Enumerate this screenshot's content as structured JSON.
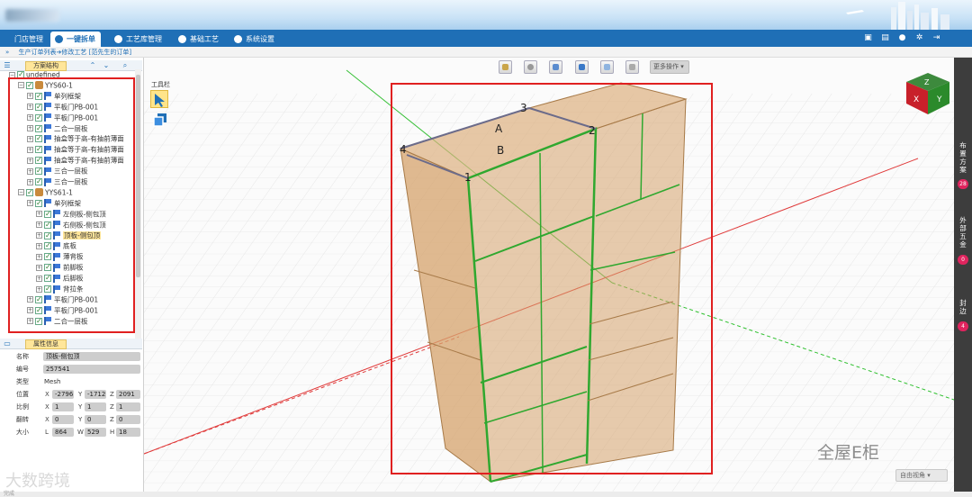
{
  "header": {
    "logo_blurred": "blurred-logo"
  },
  "nav": {
    "tabs": [
      {
        "label": "门店管理",
        "icon": "none",
        "active": false
      },
      {
        "label": "一键拆单",
        "icon": "check-circle-icon",
        "active": true
      },
      {
        "label": "工艺库管理",
        "icon": "check-circle-icon",
        "active": false
      },
      {
        "label": "基础工艺",
        "icon": "check-circle-icon",
        "active": false
      },
      {
        "label": "系统设置",
        "icon": "check-circle-icon",
        "active": false
      }
    ],
    "right_icons": [
      "calendar-icon",
      "lock-icon",
      "user-icon",
      "gear-icon",
      "exit-icon"
    ]
  },
  "breadcrumb": {
    "chevron": "»",
    "text": "生产订单列表➔修改工艺 [范先生的订单]"
  },
  "left_panel": {
    "tab_label": "方案结构",
    "tree": [
      {
        "label": "undefined",
        "indent": 0,
        "icon": "none"
      },
      {
        "label": "YYS60-1",
        "indent": 1,
        "icon": "box"
      },
      {
        "label": "单列框架",
        "indent": 2,
        "icon": "flag"
      },
      {
        "label": "平板门PB-001",
        "indent": 2,
        "icon": "flag"
      },
      {
        "label": "平板门PB-001",
        "indent": 2,
        "icon": "flag"
      },
      {
        "label": "二合一层板",
        "indent": 2,
        "icon": "flag"
      },
      {
        "label": "抽盒等于高-有抽前薄面",
        "indent": 2,
        "icon": "flag"
      },
      {
        "label": "抽盒等于高-有抽前薄面",
        "indent": 2,
        "icon": "flag"
      },
      {
        "label": "抽盒等于高-有抽前薄面",
        "indent": 2,
        "icon": "flag"
      },
      {
        "label": "三合一层板",
        "indent": 2,
        "icon": "flag"
      },
      {
        "label": "三合一层板",
        "indent": 2,
        "icon": "flag"
      },
      {
        "label": "YYS61-1",
        "indent": 1,
        "icon": "box"
      },
      {
        "label": "单列框架",
        "indent": 2,
        "icon": "flag"
      },
      {
        "label": "左侧板-侧包顶",
        "indent": 3,
        "icon": "flag"
      },
      {
        "label": "右侧板-侧包顶",
        "indent": 3,
        "icon": "flag"
      },
      {
        "label": "顶板-侧包顶",
        "indent": 3,
        "icon": "flag",
        "selected": true
      },
      {
        "label": "底板",
        "indent": 3,
        "icon": "flag"
      },
      {
        "label": "薄背板",
        "indent": 3,
        "icon": "flag"
      },
      {
        "label": "前脚板",
        "indent": 3,
        "icon": "flag"
      },
      {
        "label": "后脚板",
        "indent": 3,
        "icon": "flag"
      },
      {
        "label": "背拉条",
        "indent": 3,
        "icon": "flag"
      },
      {
        "label": "平板门PB-001",
        "indent": 2,
        "icon": "flag"
      },
      {
        "label": "平板门PB-001",
        "indent": 2,
        "icon": "flag"
      },
      {
        "label": "二合一层板",
        "indent": 2,
        "icon": "flag"
      }
    ],
    "props_tab_label": "属性信息",
    "props": {
      "name_label": "名称",
      "name": "顶板-侧包顶",
      "id_label": "编号",
      "id": "257541",
      "type_label": "类型",
      "type": "Mesh",
      "pos_label": "位置",
      "pos_x": "-2796",
      "pos_y": "-1712",
      "pos_z": "2091",
      "scale_label": "比例",
      "scale_x": "1",
      "scale_y": "1",
      "scale_z": "1",
      "rot_label": "翻转",
      "rot_x": "0",
      "rot_y": "0",
      "rot_z": "0",
      "size_label": "大小",
      "size_l": "864",
      "size_w": "529",
      "size_h": "18",
      "x": "X",
      "y": "Y",
      "z": "Z",
      "l": "L",
      "w": "W",
      "h": "H"
    }
  },
  "viewport": {
    "toolbox_label": "工具栏",
    "more_ops": "更多操作",
    "view_mode": "自由视角",
    "points": {
      "p1": "1",
      "p2": "2",
      "p3": "3",
      "p4": "4",
      "a": "A",
      "b": "B"
    },
    "colors": {
      "cabinet": "#d6a36c",
      "highlight": "#2fa82f",
      "red_box": "#e02020",
      "x_axis": "#e03030",
      "y_axis": "#30c030"
    }
  },
  "right_panel": {
    "items": [
      {
        "label": "布置方案",
        "count": "28"
      },
      {
        "label": "外部五金",
        "count": "0"
      },
      {
        "label": "封边",
        "count": "4"
      }
    ]
  },
  "watermarks": {
    "left": "大数跨境",
    "right": "全屋E柜"
  },
  "status": {
    "text": "完成"
  }
}
